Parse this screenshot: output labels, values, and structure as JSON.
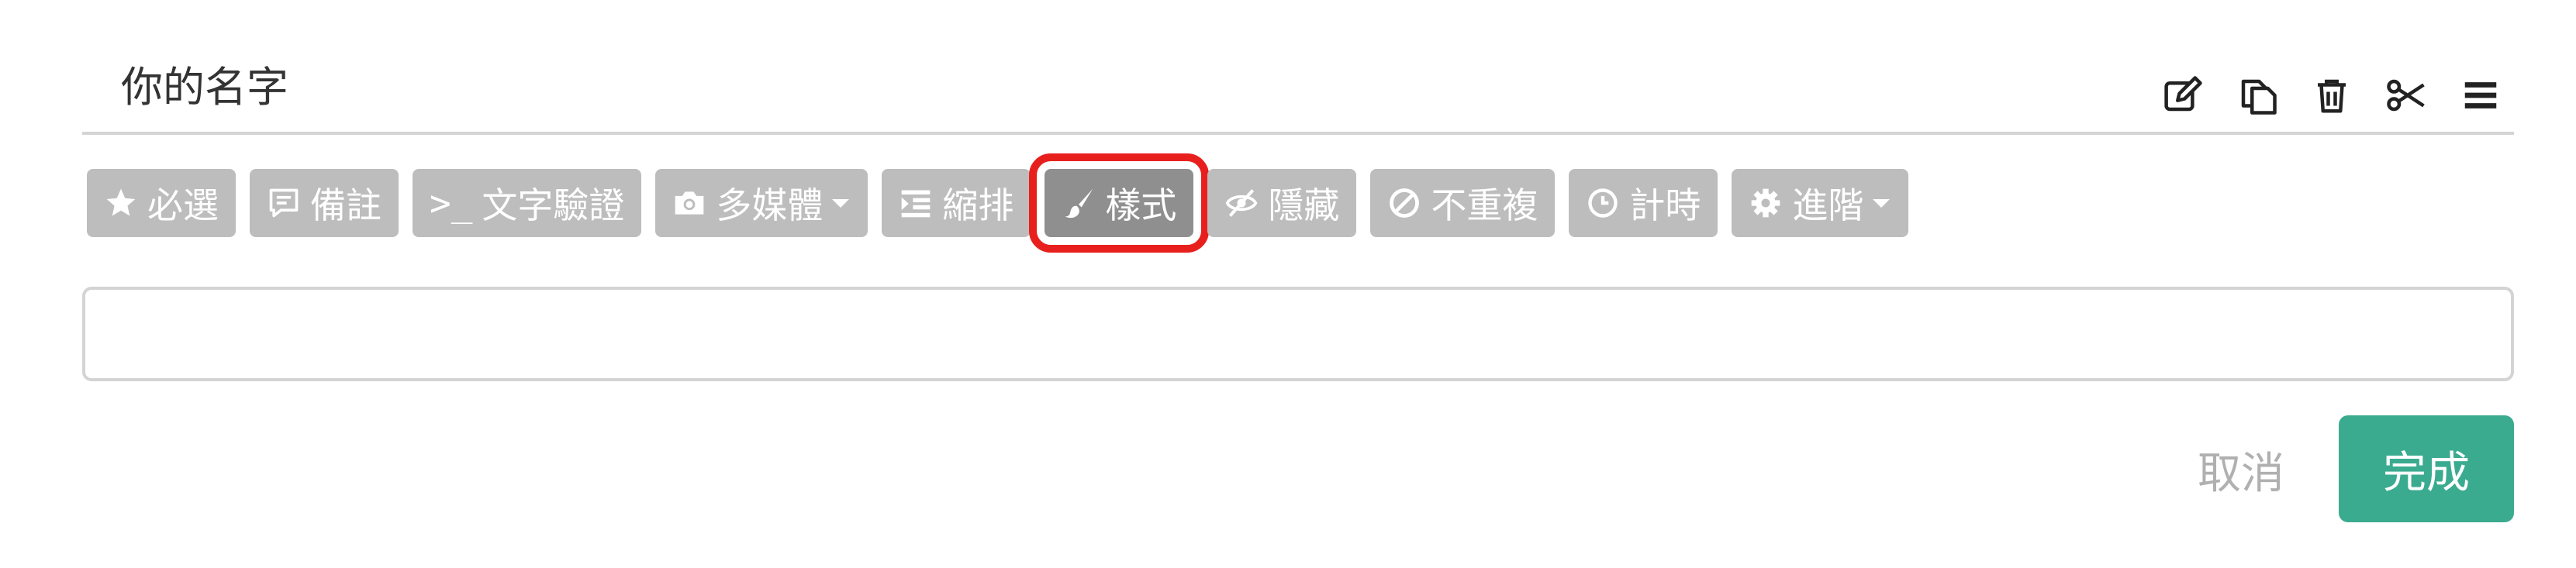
{
  "question": {
    "title": "你的名字"
  },
  "title_tools": [
    {
      "icon": "edit-icon"
    },
    {
      "icon": "copy-icon"
    },
    {
      "icon": "trash-icon"
    },
    {
      "icon": "scissors-icon"
    },
    {
      "icon": "menu-icon"
    }
  ],
  "toolbar": {
    "required": "必選",
    "note": "備註",
    "text_validation": "文字驗證",
    "multimedia": "多媒體",
    "indent": "縮排",
    "style": "樣式",
    "hide": "隱藏",
    "no_repeat": "不重複",
    "timer": "計時",
    "advanced": "進階",
    "validation_prefix": ">_"
  },
  "footer": {
    "cancel": "取消",
    "done": "完成"
  },
  "colors": {
    "button_bg": "#bdbdbd",
    "button_active_bg": "#8f8f8f",
    "highlight_outline": "#e8201d",
    "done_bg": "#3bab90"
  }
}
